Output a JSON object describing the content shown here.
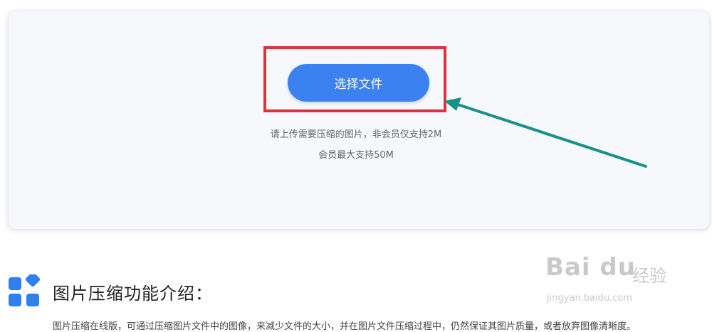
{
  "upload": {
    "button_label": "选择文件",
    "hint_line1": "请上传需要压缩的图片，非会员仅支持2M",
    "hint_line2": "会员最大支持50M"
  },
  "section": {
    "icon": "grid-apps-icon",
    "title": "图片压缩功能介绍：",
    "description": "图片压缩在线版，可通过压缩图片文件中的图像，来减少文件的大小，并在图片文件压缩过程中，仍然保证其图片质量，或者放弃图像清晰度。"
  },
  "annotation": {
    "highlight_color": "#e0323e",
    "arrow_color": "#17928a",
    "arrow_icon": "pointer-arrow-icon"
  },
  "watermark": {
    "logo": "Bai du",
    "cn": "经验",
    "url": "jingyan.baidu.com"
  },
  "colors": {
    "button": "#3b82f0",
    "icon": "#2f80ed"
  }
}
